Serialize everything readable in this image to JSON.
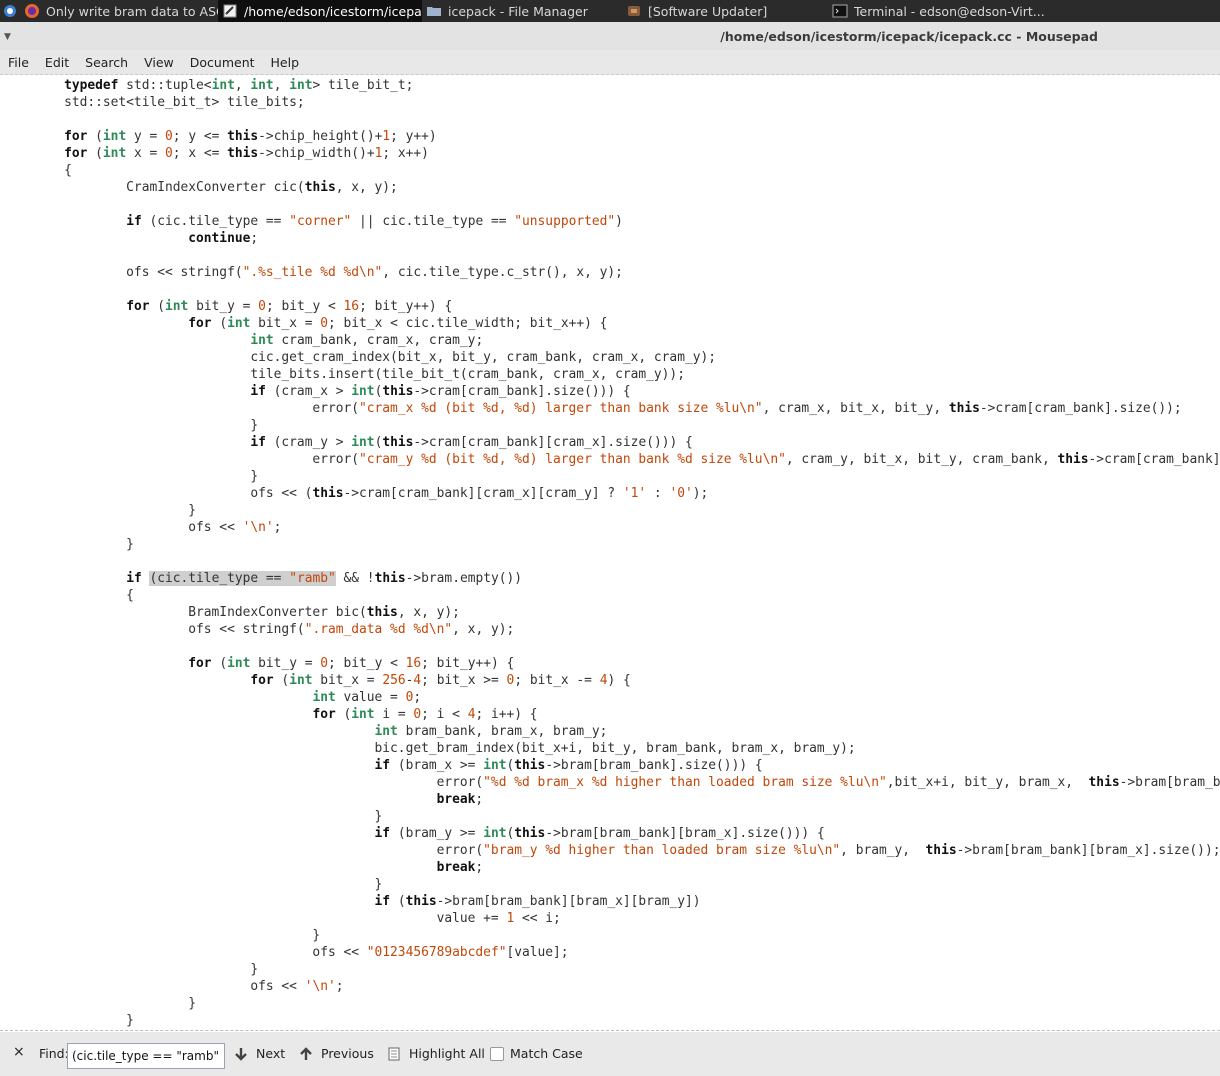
{
  "taskbar": {
    "tasks": [
      {
        "label": "Only write bram data to ASCI...",
        "icon": "firefox-icon"
      },
      {
        "label": "/home/edson/icestorm/icepa...",
        "icon": "text-editor-icon"
      },
      {
        "label": "icepack - File Manager",
        "icon": "folder-icon"
      },
      {
        "label": "[Software Updater]",
        "icon": "updater-icon"
      },
      {
        "label": "Terminal - edson@edson-Virt...",
        "icon": "terminal-icon"
      }
    ]
  },
  "window": {
    "title": "/home/edson/icestorm/icepack/icepack.cc - Mousepad"
  },
  "menu": {
    "items": [
      "File",
      "Edit",
      "Search",
      "View",
      "Document",
      "Help"
    ]
  },
  "code_lines": [
    "        typedef std::tuple<int, int, int> tile_bit_t;",
    "        std::set<tile_bit_t> tile_bits;",
    "",
    "        for (int y = 0; y <= this->chip_height()+1; y++)",
    "        for (int x = 0; x <= this->chip_width()+1; x++)",
    "        {",
    "                CramIndexConverter cic(this, x, y);",
    "",
    "                if (cic.tile_type == \"corner\" || cic.tile_type == \"unsupported\")",
    "                        continue;",
    "",
    "                ofs << stringf(\".%s_tile %d %d\\n\", cic.tile_type.c_str(), x, y);",
    "",
    "                for (int bit_y = 0; bit_y < 16; bit_y++) {",
    "                        for (int bit_x = 0; bit_x < cic.tile_width; bit_x++) {",
    "                                int cram_bank, cram_x, cram_y;",
    "                                cic.get_cram_index(bit_x, bit_y, cram_bank, cram_x, cram_y);",
    "                                tile_bits.insert(tile_bit_t(cram_bank, cram_x, cram_y));",
    "                                if (cram_x > int(this->cram[cram_bank].size())) {",
    "                                        error(\"cram_x %d (bit %d, %d) larger than bank size %lu\\n\", cram_x, bit_x, bit_y, this->cram[cram_bank].size());",
    "                                }",
    "                                if (cram_y > int(this->cram[cram_bank][cram_x].size())) {",
    "                                        error(\"cram_y %d (bit %d, %d) larger than bank %d size %lu\\n\", cram_y, bit_x, bit_y, cram_bank, this->cram[cram_bank][cram_x].size());",
    "                                }",
    "                                ofs << (this->cram[cram_bank][cram_x][cram_y] ? '1' : '0');",
    "                        }",
    "                        ofs << '\\n';",
    "                }",
    "",
    "                if (cic.tile_type == \"ramb\" && !this->bram.empty())",
    "                {",
    "                        BramIndexConverter bic(this, x, y);",
    "                        ofs << stringf(\".ram_data %d %d\\n\", x, y);",
    "",
    "                        for (int bit_y = 0; bit_y < 16; bit_y++) {",
    "                                for (int bit_x = 256-4; bit_x >= 0; bit_x -= 4) {",
    "                                        int value = 0;",
    "                                        for (int i = 0; i < 4; i++) {",
    "                                                int bram_bank, bram_x, bram_y;",
    "                                                bic.get_bram_index(bit_x+i, bit_y, bram_bank, bram_x, bram_y);",
    "                                                if (bram_x >= int(this->bram[bram_bank].size())) {",
    "                                                        error(\"%d %d bram_x %d higher than loaded bram size %lu\\n\",bit_x+i, bit_y, bram_x,  this->bram[bram_bank].size());",
    "                                                        break;",
    "                                                }",
    "                                                if (bram_y >= int(this->bram[bram_bank][bram_x].size())) {",
    "                                                        error(\"bram_y %d higher than loaded bram size %lu\\n\", bram_y,  this->bram[bram_bank][bram_x].size());",
    "                                                        break;",
    "                                                }",
    "                                                if (this->bram[bram_bank][bram_x][bram_y])",
    "                                                        value += 1 << i;",
    "                                        }",
    "                                        ofs << \"0123456789abcdef\"[value];",
    "                                }",
    "                                ofs << '\\n';",
    "                        }",
    "                }"
  ],
  "highlight_text": "(cic.tile_type == \"ramb\"",
  "findbar": {
    "close": "×",
    "find_label": "Find:",
    "find_value": "(cic.tile_type == \"ramb\"",
    "next": "Next",
    "previous": "Previous",
    "highlight_all": "Highlight All",
    "match_case": "Match Case"
  },
  "colors": {
    "keyword": "#111111",
    "type": "#2e8b57",
    "string": "#c1470a",
    "highlight": "#cfcfcf"
  }
}
